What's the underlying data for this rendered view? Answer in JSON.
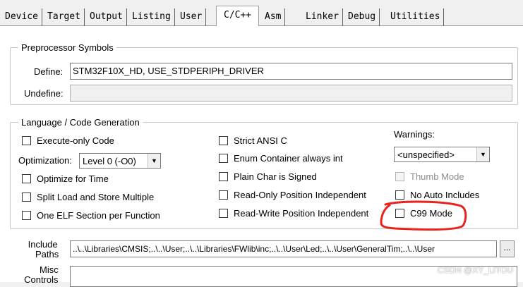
{
  "tabs": [
    {
      "label": "Device"
    },
    {
      "label": "Target"
    },
    {
      "label": "Output"
    },
    {
      "label": "Listing"
    },
    {
      "label": "User"
    },
    {
      "label": "C/C++"
    },
    {
      "label": "Asm"
    },
    {
      "label": "Linker"
    },
    {
      "label": "Debug"
    },
    {
      "label": "Utilities"
    }
  ],
  "active_tab": "C/C++",
  "preprocessor": {
    "title": "Preprocessor Symbols",
    "define_label": "Define:",
    "define_value": "STM32F10X_HD, USE_STDPERIPH_DRIVER",
    "undefine_label": "Undefine:",
    "undefine_value": ""
  },
  "language": {
    "title": "Language / Code Generation",
    "execute_only": "Execute-only Code",
    "optimization_label": "Optimization:",
    "optimization_value": "Level 0 (-O0)",
    "optimize_time": "Optimize for Time",
    "split_load": "Split Load and Store Multiple",
    "one_elf": "One ELF Section per Function",
    "strict_ansi": "Strict ANSI C",
    "enum_container": "Enum Container always int",
    "plain_char": "Plain Char is Signed",
    "ro_pi": "Read-Only Position Independent",
    "rw_pi": "Read-Write Position Independent",
    "warnings_label": "Warnings:",
    "warnings_value": "<unspecified>",
    "thumb_mode": "Thumb Mode",
    "no_auto_includes": "No Auto Includes",
    "c99_mode": "C99 Mode"
  },
  "include": {
    "label_line1": "Include",
    "label_line2": "Paths",
    "value": "..\\..\\Libraries\\CMSIS;..\\..\\User;..\\..\\Libraries\\FWlib\\inc;..\\..\\User\\Led;..\\..\\User\\GeneralTim;..\\..\\User",
    "browse_label": "..."
  },
  "misc": {
    "label_line1": "Misc",
    "label_line2": "Controls",
    "value": ""
  },
  "watermark": "CSDN @XY_LITOU",
  "annotation_color": "#e8221c"
}
